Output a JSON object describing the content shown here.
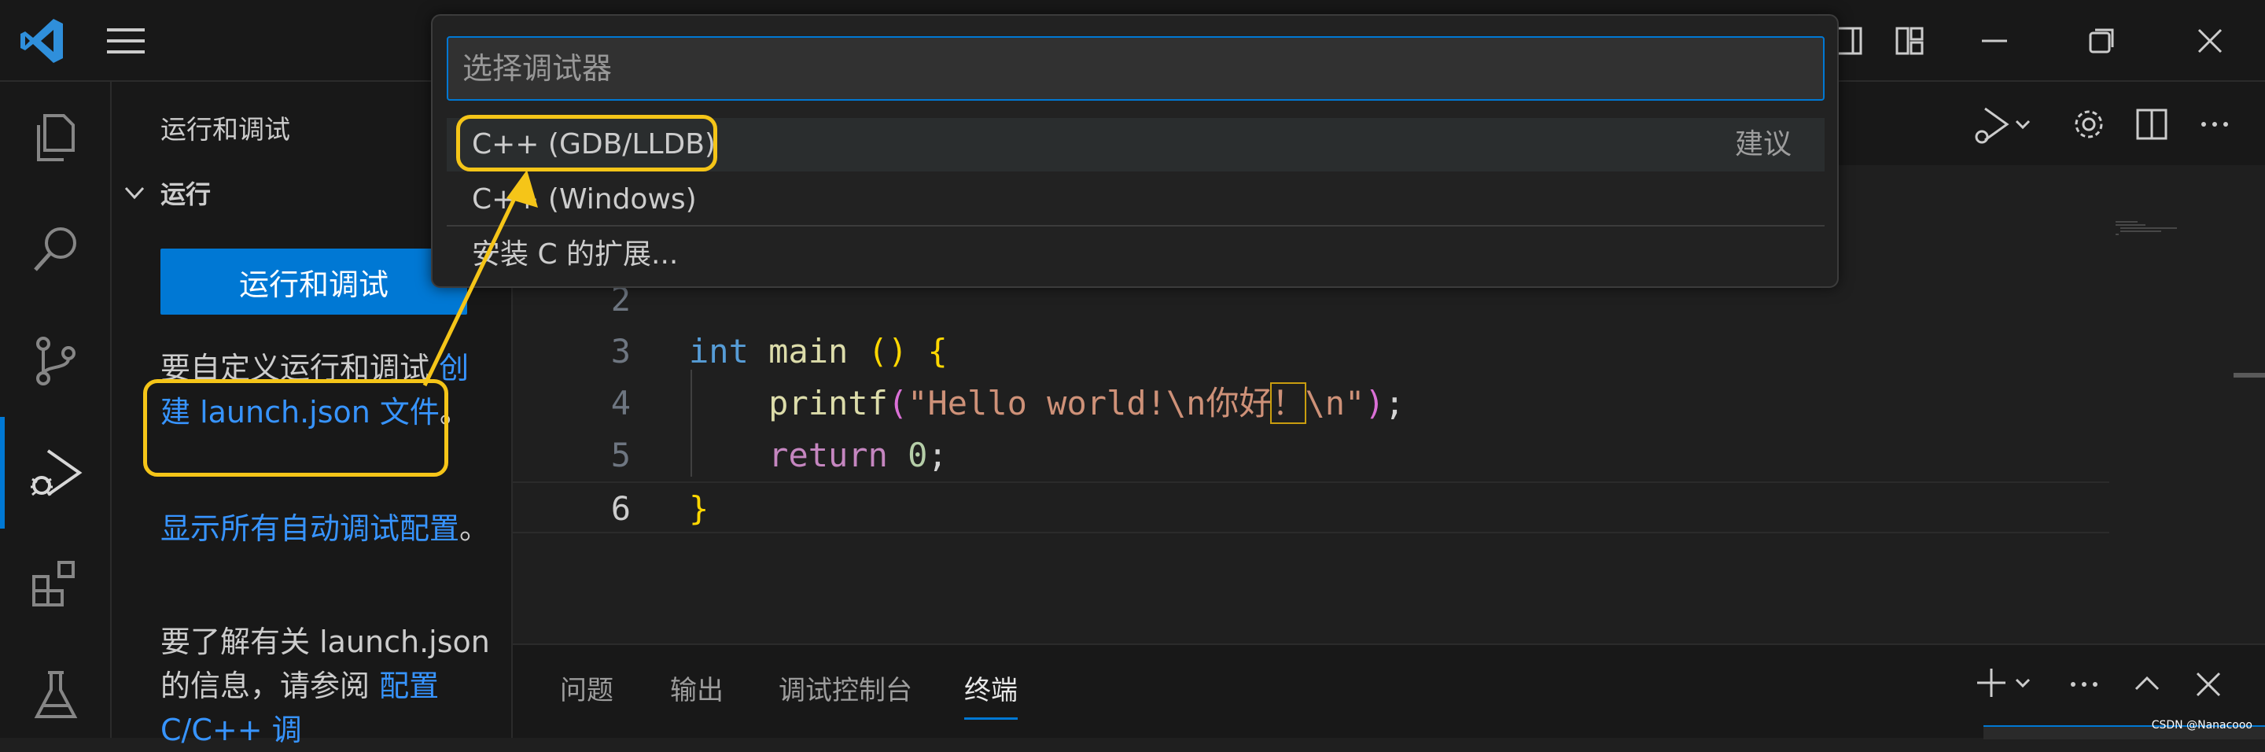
{
  "quick_pick": {
    "placeholder": "选择调试器",
    "items": [
      {
        "label": "C++ (GDB/LLDB)",
        "hint": "建议"
      },
      {
        "label": "C++ (Windows)"
      },
      {
        "label": "安装 C 的扩展..."
      }
    ]
  },
  "sidebar": {
    "title": "运行和调试",
    "section": "运行",
    "run_button": "运行和调试",
    "customize_text": "要自定义运行和调试",
    "create_link": "创建 launch.json 文件",
    "period": "。",
    "show_all_link": "显示所有自动调试配置",
    "learn_more_text": "要了解有关 launch.json 的信息，请参阅",
    "configure_link": "配置 C/C++ 调"
  },
  "editor": {
    "lines": [
      {
        "num": "2",
        "text": ""
      },
      {
        "num": "3",
        "text": "int main () {"
      },
      {
        "num": "4",
        "text": "    printf(\"Hello world!\\n你好！\\n\");"
      },
      {
        "num": "5",
        "text": "    return 0;"
      },
      {
        "num": "6",
        "text": "}"
      }
    ]
  },
  "panel": {
    "tabs": [
      "问题",
      "输出",
      "调试控制台",
      "终端"
    ],
    "active_tab": "终端"
  },
  "watermark": "CSDN @Nanacooo",
  "colors": {
    "accent": "#0078d4",
    "annotation": "#f5c518",
    "link": "#3794ff"
  }
}
